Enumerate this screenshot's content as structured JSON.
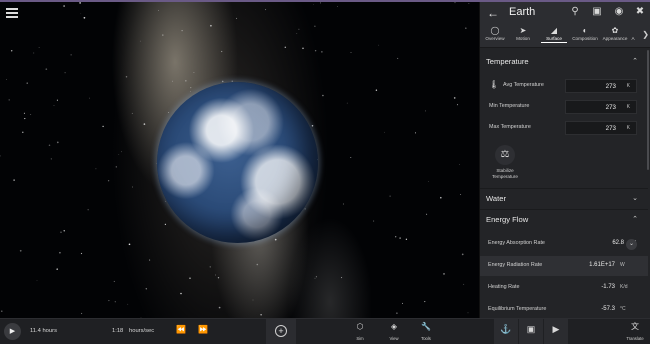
{
  "app": {
    "accent_color": "#6a5a86",
    "panel_color": "#232427"
  },
  "header": {
    "title": "Earth",
    "back_icon": "arrow-left-icon",
    "icons": [
      "search-icon",
      "info-card-icon",
      "eye-icon",
      "close-icon"
    ]
  },
  "tabs": [
    {
      "label": "Overview",
      "icon": "globe-icon",
      "active": false
    },
    {
      "label": "Motion",
      "icon": "motion-icon",
      "active": false
    },
    {
      "label": "Surface",
      "icon": "surface-icon",
      "active": true
    },
    {
      "label": "Composition",
      "icon": "composition-icon",
      "active": false
    },
    {
      "label": "Appearance",
      "icon": "palette-icon",
      "active": false
    },
    {
      "label": "A",
      "icon": "more-icon",
      "active": false
    }
  ],
  "temperature": {
    "title": "Temperature",
    "rows": [
      {
        "label": "Avg Temperature",
        "value": "273",
        "unit": "K"
      },
      {
        "label": "Min Temperature",
        "value": "273",
        "unit": "K"
      },
      {
        "label": "Max Temperature",
        "value": "273",
        "unit": "K"
      }
    ],
    "stabilize_label": "Stabilize Temperature"
  },
  "water": {
    "title": "Water"
  },
  "energy_flow": {
    "title": "Energy Flow",
    "rows": [
      {
        "label": "Energy Absorption Rate",
        "value": "62.8",
        "unit": "PW"
      },
      {
        "label": "Energy Radiation Rate",
        "value": "1.61E+17",
        "unit": "W"
      },
      {
        "label": "Heating Rate",
        "value": "-1.73",
        "unit": "K/d"
      },
      {
        "label": "Equilibrium Temperature",
        "value": "-57.3",
        "unit": "°C"
      }
    ]
  },
  "bottom": {
    "elapsed": "11.4 hours",
    "rate_value": "1:18",
    "rate_unit": "hours/sec",
    "sim_label": "Sim",
    "view_label": "View",
    "tools_label": "Tools",
    "translate_label": "Translate"
  }
}
